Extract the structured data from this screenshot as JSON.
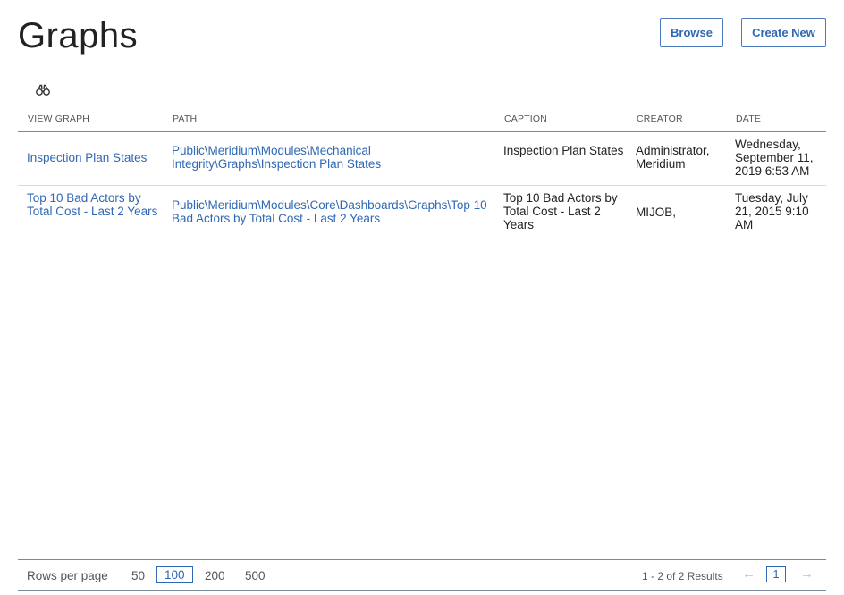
{
  "header": {
    "title": "Graphs",
    "browse_label": "Browse",
    "create_label": "Create New"
  },
  "icons": {
    "search": "binoculars-icon",
    "prev": "arrow-left-icon",
    "next": "arrow-right-icon"
  },
  "colors": {
    "link": "#2f68b5",
    "border": "#4a7bbf"
  },
  "table": {
    "columns": [
      "VIEW GRAPH",
      "PATH",
      "CAPTION",
      "CREATOR",
      "DATE"
    ],
    "rows": [
      {
        "view": "Inspection Plan States",
        "path": "Public\\Meridium\\Modules\\Mechanical Integrity\\Graphs\\Inspection Plan States",
        "caption": "Inspection Plan States",
        "creator": "Administrator, Meridium",
        "date": "Wednesday, September 11, 2019 6:53 AM"
      },
      {
        "view": "Top 10 Bad Actors by Total Cost - Last 2 Years",
        "path": "Public\\Meridium\\Modules\\Core\\Dashboards\\Graphs\\Top 10 Bad Actors by Total Cost - Last 2 Years",
        "caption": "Top 10 Bad Actors by Total Cost - Last 2 Years",
        "creator": "MIJOB,",
        "date": "Tuesday, July 21, 2015 9:10 AM"
      }
    ]
  },
  "footer": {
    "rows_per_page_label": "Rows per page",
    "options": [
      "50",
      "100",
      "200",
      "500"
    ],
    "selected": "100",
    "results": "1 - 2 of 2 Results",
    "current_page": "1",
    "prev_glyph": "←",
    "next_glyph": "→"
  }
}
